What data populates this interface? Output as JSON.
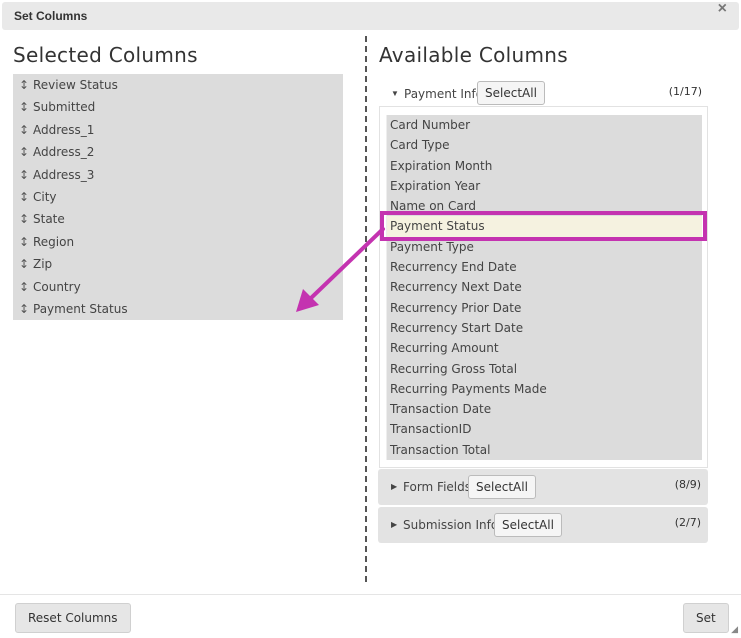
{
  "dialog": {
    "title": "Set Columns",
    "close_glyph": "×"
  },
  "selected": {
    "heading": "Selected Columns",
    "drag_glyph": "↕",
    "items": [
      "Review Status",
      "Submitted",
      "Address_1",
      "Address_2",
      "Address_3",
      "City",
      "State",
      "Region",
      "Zip",
      "Country",
      "Payment Status"
    ]
  },
  "available": {
    "heading": "Available Columns",
    "groups": [
      {
        "label": "Payment Info",
        "select_all": "SelectAll",
        "count": "(1/17)",
        "expanded": true,
        "items": [
          "Card Number",
          "Card Type",
          "Expiration Month",
          "Expiration Year",
          "Name on Card",
          "Payment Status",
          "Payment Type",
          "Recurrency End Date",
          "Recurrency Next Date",
          "Recurrency Prior Date",
          "Recurrency Start Date",
          "Recurring Amount",
          "Recurring Gross Total",
          "Recurring Payments Made",
          "Transaction Date",
          "TransactionID",
          "Transaction Total"
        ],
        "highlighted_item": "Payment Status"
      },
      {
        "label": "Form Fields",
        "select_all": "SelectAll",
        "count": "(8/9)",
        "expanded": false
      },
      {
        "label": "Submission Info",
        "select_all": "SelectAll",
        "count": "(2/7)",
        "expanded": false
      }
    ]
  },
  "footer": {
    "reset_label": "Reset Columns",
    "set_label": "Set"
  },
  "icons": {
    "caret_down": "▼",
    "caret_right": "▶",
    "resize": "◢"
  },
  "colors": {
    "highlight": "#c433b0",
    "list_bg": "#dcdcdc",
    "titlebar_bg": "#e9e9e9"
  }
}
